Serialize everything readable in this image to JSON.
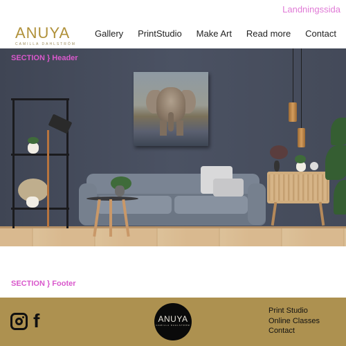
{
  "header": {
    "top_link": "Landningssida",
    "logo": {
      "name": "ANUYA",
      "tagline": "CAMILLA DAHLSTRÖM"
    },
    "nav": [
      "Gallery",
      "PrintStudio",
      "Make Art",
      "Read more",
      "Contact"
    ]
  },
  "sections": {
    "header_label": "SECTION } Header",
    "footer_label": "SECTION } Footer"
  },
  "footer": {
    "social": [
      "instagram-icon",
      "facebook-icon"
    ],
    "facebook_glyph": "f",
    "logo": {
      "name": "ANUYA",
      "tagline": "CAMILLA DAHLSTRÖM"
    },
    "links": [
      "Print Studio",
      "Online Classes",
      "Contact"
    ]
  },
  "colors": {
    "accent_pink": "#d958cc",
    "brand_gold": "#ad9150",
    "logo_gold": "#b0913a"
  }
}
